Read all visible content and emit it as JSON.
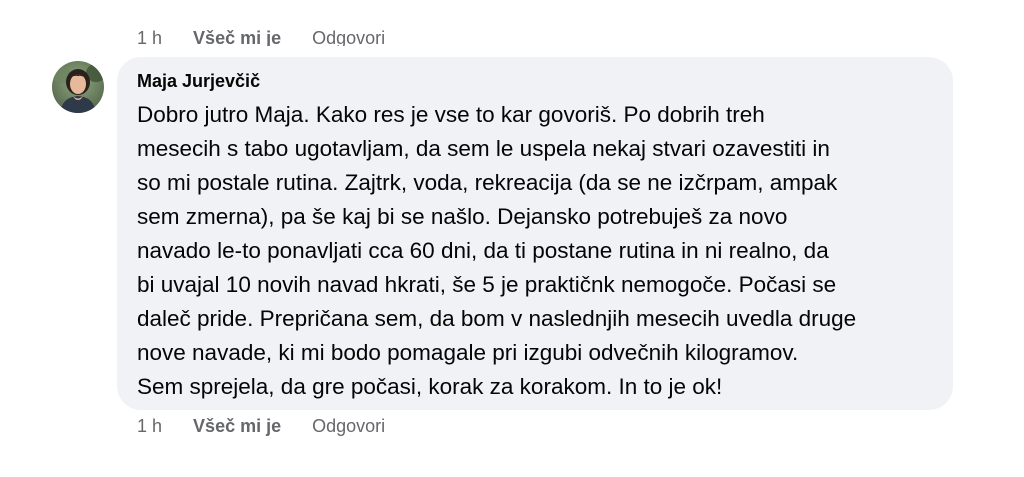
{
  "previous_comment": {
    "time": "1 h",
    "like_label": "Všeč mi je",
    "reply_label": "Odgovori"
  },
  "comment": {
    "author": "Maja Jurjevčič",
    "avatar_icon": "user-avatar-photo",
    "lines": [
      "Dobro jutro Maja. Kako res je vse to kar govoriš. Po dobrih treh",
      "mesecih s tabo ugotavljam, da sem le uspela nekaj stvari ozavestiti in",
      "so mi postale rutina. Zajtrk, voda, rekreacija (da se ne izčrpam, ampak",
      "sem zmerna), pa še kaj bi se našlo. Dejansko potrebuješ za novo",
      "navado le-to ponavljati cca 60 dni, da ti postane rutina in ni realno, da",
      "bi uvajal 10 novih navad hkrati, še 5 je praktičnk nemogoče. Počasi se",
      "daleč pride. Prepričana sem, da bom v naslednjih mesecih uvedla druge",
      "nove navade, ki mi bodo pomagale pri izgubi odvečnih kilogramov.",
      "Sem sprejela, da gre počasi, korak za korakom. In to je ok!"
    ],
    "time": "1 h",
    "like_label": "Všeč mi je",
    "reply_label": "Odgovori"
  },
  "colors": {
    "bubble_bg": "#f0f2f5",
    "text": "#050505",
    "secondary_text": "#65676b"
  }
}
